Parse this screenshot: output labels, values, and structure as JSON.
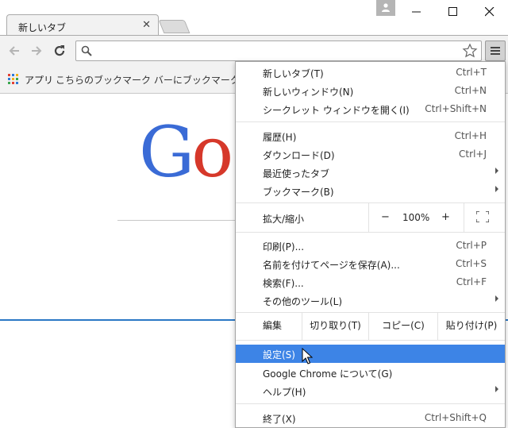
{
  "tab": {
    "title": "新しいタブ"
  },
  "toolbar": {
    "omnibox_value": ""
  },
  "bookmarks": {
    "apps_label": "アプリ",
    "prompt": "こちらのブックマーク バーにブックマークを追加すると"
  },
  "logo": {
    "first": "G",
    "second": "o"
  },
  "menu": {
    "group1": [
      {
        "label": "新しいタブ(T)",
        "shortcut": "Ctrl+T"
      },
      {
        "label": "新しいウィンドウ(N)",
        "shortcut": "Ctrl+N"
      },
      {
        "label": "シークレット ウィンドウを開く(I)",
        "shortcut": "Ctrl+Shift+N"
      }
    ],
    "group2": [
      {
        "label": "履歴(H)",
        "shortcut": "Ctrl+H"
      },
      {
        "label": "ダウンロード(D)",
        "shortcut": "Ctrl+J"
      },
      {
        "label": "最近使ったタブ"
      },
      {
        "label": "ブックマーク(B)"
      }
    ],
    "zoom": {
      "label": "拡大/縮小",
      "minus": "−",
      "value": "100%",
      "plus": "+"
    },
    "group3": [
      {
        "label": "印刷(P)...",
        "shortcut": "Ctrl+P"
      },
      {
        "label": "名前を付けてページを保存(A)...",
        "shortcut": "Ctrl+S"
      },
      {
        "label": "検索(F)...",
        "shortcut": "Ctrl+F"
      },
      {
        "label": "その他のツール(L)"
      }
    ],
    "edit": {
      "label": "編集",
      "cut": "切り取り(T)",
      "copy": "コピー(C)",
      "paste": "貼り付け(P)"
    },
    "group4": [
      {
        "label": "設定(S)"
      },
      {
        "label": "Google Chrome について(G)"
      },
      {
        "label": "ヘルプ(H)"
      }
    ],
    "exit": {
      "label": "終了(X)",
      "shortcut": "Ctrl+Shift+Q"
    }
  },
  "colors": {
    "highlight": "#3d84e6",
    "window_border": "#2b78c5"
  }
}
